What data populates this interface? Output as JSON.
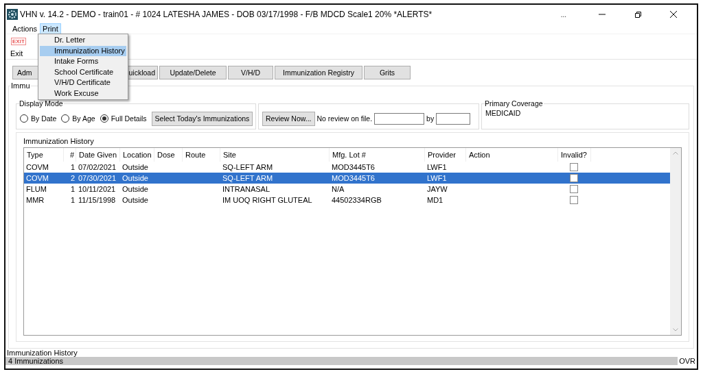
{
  "window": {
    "title": "VHN v. 14.2 - DEMO - train01 - # 1024  LATESHA JAMES - DOB 03/17/1998 - F/B MDCD  Scale1  20% *ALERTS*",
    "more": "..."
  },
  "menubar": [
    {
      "label": "Actions",
      "selected": false
    },
    {
      "label": "Print",
      "selected": true
    }
  ],
  "print_menu": [
    {
      "label": "Dr. Letter",
      "selected": false
    },
    {
      "label": "Immunization History",
      "selected": true
    },
    {
      "label": "Intake Forms",
      "selected": false
    },
    {
      "label": "School Certificate",
      "selected": false
    },
    {
      "label": "V/H/D Certificate",
      "selected": false
    },
    {
      "label": "Work Excuse",
      "selected": false
    }
  ],
  "toolbar": {
    "exit_icon_text": "EXIT",
    "exit_label": "Exit"
  },
  "tabs": [
    {
      "label": "Adm"
    },
    {
      "label": "uickload"
    },
    {
      "label": "Update/Delete"
    },
    {
      "label": "V/H/D"
    },
    {
      "label": "Immunization Registry"
    },
    {
      "label": "Grits"
    }
  ],
  "group_title": "Immu",
  "display_mode": {
    "title": "Display Mode",
    "options": [
      {
        "label": "By Date",
        "selected": false
      },
      {
        "label": "By Age",
        "selected": false
      },
      {
        "label": "Full Details",
        "selected": true
      }
    ],
    "button": "Select Today's Immunizations"
  },
  "review": {
    "button": "Review Now...",
    "status": "No review on file.",
    "by_label": "by"
  },
  "coverage": {
    "title": "Primary Coverage",
    "value": "MEDICAID"
  },
  "history": {
    "title": "Immunization History",
    "columns": [
      "Type",
      "#",
      "Date Given",
      "Location",
      "Dose",
      "Route",
      "Site",
      "Mfg. Lot #",
      "Provider",
      "Action",
      "Invalid?"
    ],
    "rows": [
      {
        "cells": [
          "COVM",
          "1",
          "07/02/2021",
          "Outside",
          "",
          "",
          "SQ-LEFT ARM",
          "MOD3445T6",
          "LWF1",
          ""
        ],
        "invalid": false,
        "selected": false
      },
      {
        "cells": [
          "COVM",
          "2",
          "07/30/2021",
          "Outside",
          "",
          "",
          "SQ-LEFT ARM",
          "MOD3445T6",
          "LWF1",
          ""
        ],
        "invalid": false,
        "selected": true
      },
      {
        "cells": [
          "FLUM",
          "1",
          "10/11/2021",
          "Outside",
          "",
          "",
          "INTRANASAL",
          "N/A",
          "JAYW",
          ""
        ],
        "invalid": false,
        "selected": false
      },
      {
        "cells": [
          "MMR",
          "1",
          "11/15/1998",
          "Outside",
          "",
          "",
          "IM UOQ RIGHT GLUTEAL",
          "44502334RGB",
          "MD1",
          ""
        ],
        "invalid": false,
        "selected": false
      }
    ]
  },
  "status_bar": {
    "title": "Immunization History",
    "count": "4 Immunizations",
    "mode": "OVR"
  }
}
